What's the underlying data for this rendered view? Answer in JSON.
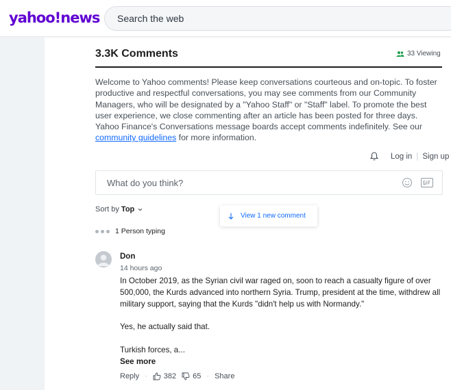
{
  "header": {
    "logo_main": "yahoo",
    "logo_bang": "!",
    "logo_sub": "news",
    "search_placeholder": "Search the web"
  },
  "comments": {
    "title": "3.3K Comments",
    "viewing": "33 Viewing",
    "welcome_text": "Welcome to Yahoo comments! Please keep conversations courteous and on-topic. To foster productive and respectful conversations, you may see comments from our Community Managers, who will be designated by a \"Yahoo Staff\" or \"Staff\" label. To promote the best user experience, we close commenting after an article has been posted for three days. Yahoo Finance's Conversations message boards accept comments indefinitely. See our ",
    "guidelines_link": "community guidelines",
    "welcome_tail": " for more information.",
    "login": "Log in",
    "signup": "Sign up",
    "composer_placeholder": "What do you think?",
    "sort_prefix": "Sort by",
    "sort_value": "Top",
    "new_comment": "View 1 new comment",
    "typing": "1 Person typing"
  },
  "comment": {
    "author": "Don",
    "time": "14 hours ago",
    "para1": "In October 2019, as the Syrian civil war raged on, soon to reach a casualty figure of over 500,000, the Kurds advanced into northern Syria. Trump, president at the time, withdrew all military support, saying that the Kurds \"didn't help us with Normandy.\"",
    "para2": "Yes, he actually said that.",
    "para3": "Turkish forces, a...",
    "see_more": "See more",
    "reply": "Reply",
    "likes": "382",
    "dislikes": "65",
    "share": "Share"
  },
  "colors": {
    "brand": "#6001d2",
    "link": "#0f69ff",
    "viewing_icon": "#1a9d4b"
  },
  "icons": [
    "users-icon",
    "bell-icon",
    "emoji-icon",
    "gif-icon",
    "chevron-down-icon",
    "arrow-down-icon",
    "avatar-icon",
    "thumbs-up-icon",
    "thumbs-down-icon"
  ]
}
